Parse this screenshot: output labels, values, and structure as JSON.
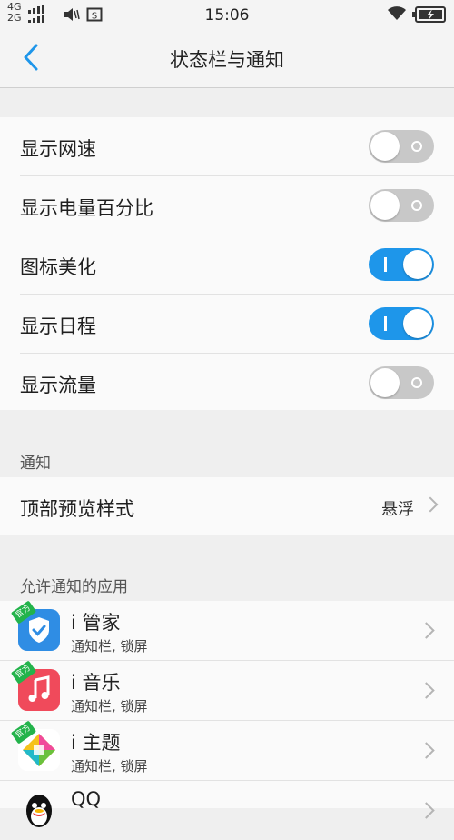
{
  "status_bar": {
    "network_4g": "4G",
    "network_2g": "2G",
    "time": "15:06",
    "icons": [
      "signal-icon",
      "volume-icon",
      "screenshot-icon",
      "wifi-icon",
      "battery-icon"
    ]
  },
  "header": {
    "back_icon": "back-chevron-icon",
    "title": "状态栏与通知"
  },
  "toggles": [
    {
      "label": "显示网速",
      "state": "off"
    },
    {
      "label": "显示电量百分比",
      "state": "off"
    },
    {
      "label": "图标美化",
      "state": "on"
    },
    {
      "label": "显示日程",
      "state": "on"
    },
    {
      "label": "显示流量",
      "state": "off"
    }
  ],
  "notification_section": {
    "header": "通知",
    "preview_style_label": "顶部预览样式",
    "preview_style_value": "悬浮"
  },
  "apps_section": {
    "header": "允许通知的应用",
    "badge": "官方",
    "apps": [
      {
        "name": "i 管家",
        "subtitle": "通知栏, 锁屏",
        "icon": "shield-check-icon",
        "icon_color": "#2f8de4"
      },
      {
        "name": "i 音乐",
        "subtitle": "通知栏, 锁屏",
        "icon": "music-note-icon",
        "icon_color": "#f04a5b"
      },
      {
        "name": "i 主题",
        "subtitle": "通知栏, 锁屏",
        "icon": "theme-diamond-icon",
        "icon_color": "#f5c21b"
      },
      {
        "name": "QQ",
        "subtitle": "",
        "icon": "qq-penguin-icon",
        "icon_color": "#111111"
      }
    ]
  },
  "colors": {
    "accent": "#1e96ea",
    "toggle_off": "#c8c8c8",
    "badge_green": "#23b34b"
  }
}
